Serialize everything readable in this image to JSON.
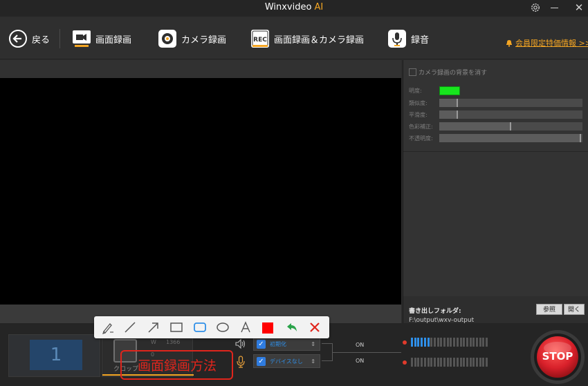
{
  "titlebar": {
    "app_name": "Winxvideo",
    "app_suffix": "AI",
    "icons": [
      "gear-icon",
      "minimize-icon",
      "close-icon"
    ]
  },
  "toolbar": {
    "back_label": "戻る",
    "screen_record_label": "画面録画",
    "camera_record_label": "カメラ録画",
    "screen_camera_label": "画面録画＆カメラ録画",
    "audio_record_label": "録音",
    "rec_badge": "REC",
    "member_link": "会員限定特価情報 >>"
  },
  "camera_settings": {
    "remove_background_label": "カメラ録画の背景を消す",
    "brightness_label": "明度:",
    "brightness_color": "#17e51d",
    "sliders": [
      {
        "label": "類似度:",
        "value": 0.13
      },
      {
        "label": "平滑度:",
        "value": 0.13
      },
      {
        "label": "色彩補正:",
        "value": 0.5
      },
      {
        "label": "不透明度:",
        "value": 0.99
      }
    ]
  },
  "output": {
    "folder_label": "書き出しフォルダ:",
    "folder_path": "F:\\output\\wxv-output",
    "browse_label": "参照",
    "open_label": "開く"
  },
  "bottom": {
    "screen_number": "1",
    "crop_label": "クロップ",
    "crop_w_label": "W",
    "crop_w_value": "1366",
    "crop_h_value": "0",
    "speaker_device": "初期化",
    "mic_device": "デバイスなし",
    "speaker_status": "ON",
    "mic_status": "ON",
    "speaker_level": 0.25,
    "mic_level": 0.0,
    "stop_label": "STOP"
  },
  "drawing_tools": [
    "pen-icon",
    "line-icon",
    "arrow-icon",
    "rectangle-icon",
    "rounded-rectangle-icon",
    "ellipse-icon",
    "text-icon",
    "color-swatch",
    "undo-icon",
    "clear-icon"
  ],
  "colors": {
    "accent": "#f5a623",
    "stop_red": "#d8202a",
    "selection_blue": "#2f8fe8",
    "pen_color": "#ff0000"
  },
  "overlay": {
    "caption": "画面録画方法"
  }
}
